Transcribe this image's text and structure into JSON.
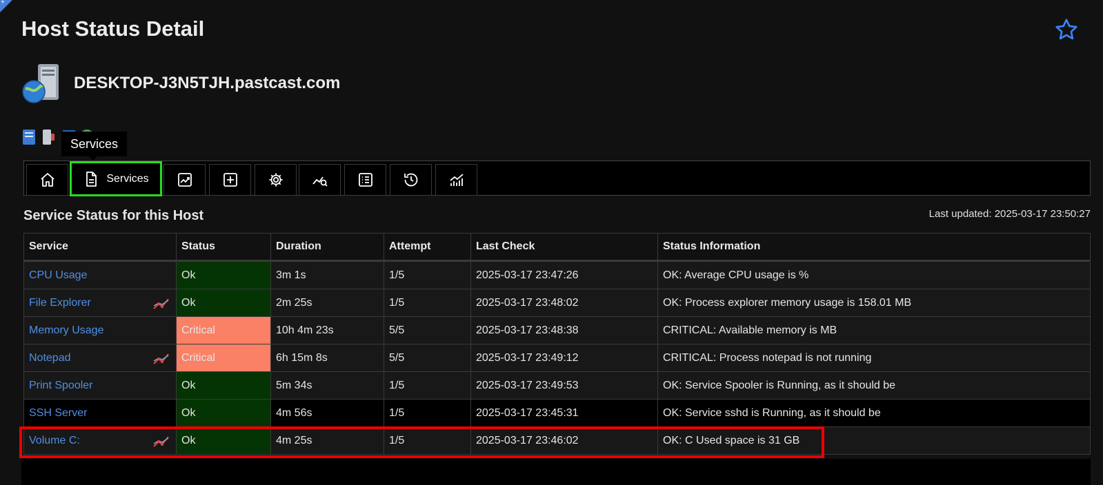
{
  "page": {
    "title": "Host Status Detail"
  },
  "host": {
    "name": "DESKTOP-J3N5TJH.pastcast.com"
  },
  "tooltip": {
    "text": "Services"
  },
  "toolbar": {
    "buttons": [
      {
        "icon": "home-icon"
      },
      {
        "icon": "document-icon",
        "label": "Services"
      },
      {
        "icon": "trend-chart-icon"
      },
      {
        "icon": "plus-square-icon"
      },
      {
        "icon": "gear-icon"
      },
      {
        "icon": "chart-search-icon"
      },
      {
        "icon": "list-icon"
      },
      {
        "icon": "history-icon"
      },
      {
        "icon": "bar-chart-icon"
      }
    ]
  },
  "section": {
    "title": "Service Status for this Host",
    "last_updated": "Last updated: 2025-03-17 23:50:27"
  },
  "table": {
    "headers": [
      "Service",
      "Status",
      "Duration",
      "Attempt",
      "Last Check",
      "Status Information"
    ],
    "rows": [
      {
        "service": "CPU Usage",
        "graph": false,
        "status": "Ok",
        "duration": "3m 1s",
        "attempt": "1/5",
        "last_check": "2025-03-17 23:47:26",
        "info": "OK: Average CPU usage is %"
      },
      {
        "service": "File Explorer",
        "graph": true,
        "status": "Ok",
        "duration": "2m 25s",
        "attempt": "1/5",
        "last_check": "2025-03-17 23:48:02",
        "info": "OK: Process explorer memory usage is 158.01 MB"
      },
      {
        "service": "Memory Usage",
        "graph": false,
        "status": "Critical",
        "duration": "10h 4m 23s",
        "attempt": "5/5",
        "last_check": "2025-03-17 23:48:38",
        "info": "CRITICAL: Available memory is MB"
      },
      {
        "service": "Notepad",
        "graph": true,
        "status": "Critical",
        "duration": "6h 15m 8s",
        "attempt": "5/5",
        "last_check": "2025-03-17 23:49:12",
        "info": "CRITICAL: Process notepad is not running"
      },
      {
        "service": "Print Spooler",
        "graph": false,
        "status": "Ok",
        "duration": "5m 34s",
        "attempt": "1/5",
        "last_check": "2025-03-17 23:49:53",
        "info": "OK: Service Spooler is Running, as it should be"
      },
      {
        "service": "SSH Server",
        "graph": false,
        "status": "Ok",
        "duration": "4m 56s",
        "attempt": "1/5",
        "last_check": "2025-03-17 23:45:31",
        "info": "OK: Service sshd is Running, as it should be"
      },
      {
        "service": "Volume C:",
        "graph": true,
        "status": "Ok",
        "duration": "4m 25s",
        "attempt": "1/5",
        "last_check": "2025-03-17 23:46:02",
        "info": "OK: C Used space is 31 GB"
      }
    ]
  },
  "colors": {
    "ok": "#043404",
    "critical": "#fa8066",
    "link": "#4f8fe6",
    "active_tab": "#22dd22",
    "highlight": "#ee0000"
  }
}
